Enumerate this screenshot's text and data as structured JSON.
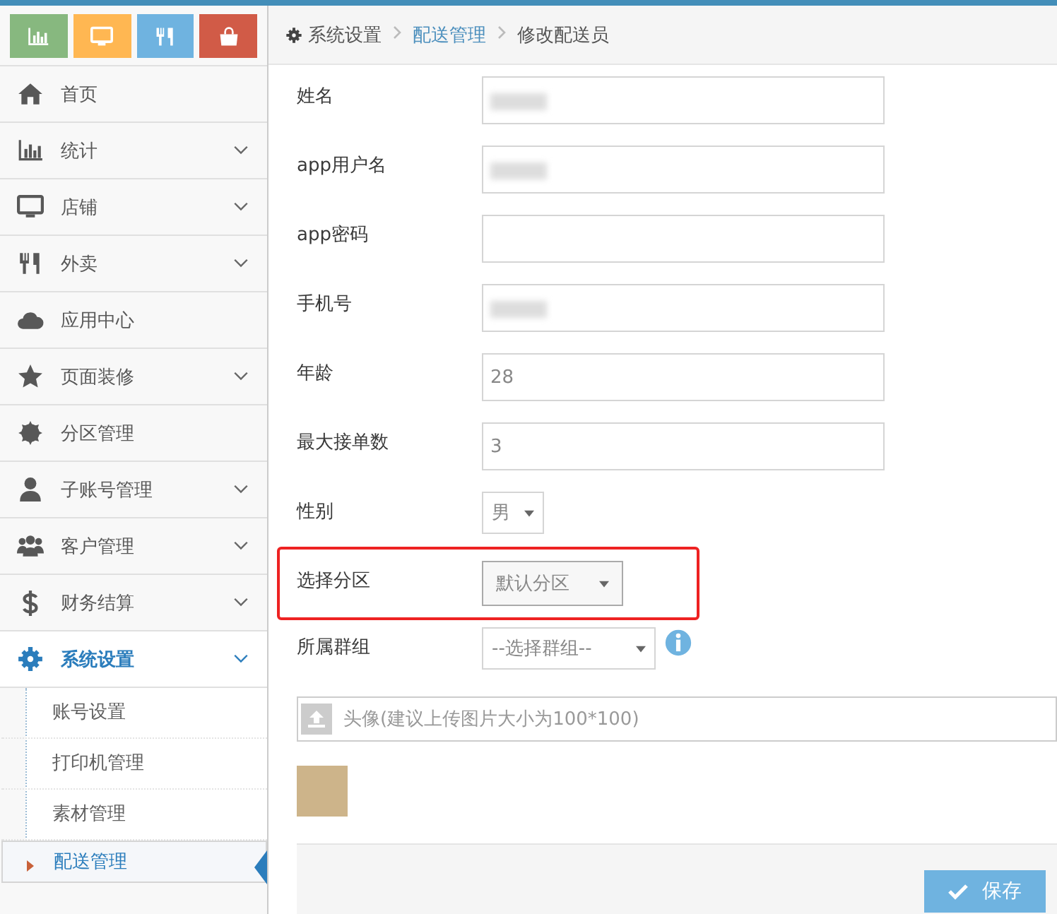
{
  "shortcuts": [
    {
      "kind": "chart",
      "color": "#87b87f"
    },
    {
      "kind": "monitor",
      "color": "#ffb752"
    },
    {
      "kind": "fork",
      "color": "#6fb3e0"
    },
    {
      "kind": "bag",
      "color": "#d15b47"
    }
  ],
  "sidebar": {
    "items": [
      {
        "label": "首页",
        "kind": "home",
        "expandable": false,
        "expanded": false
      },
      {
        "label": "统计",
        "kind": "chart",
        "expandable": true,
        "expanded": false
      },
      {
        "label": "店铺",
        "kind": "monitor",
        "expandable": true,
        "expanded": false
      },
      {
        "label": "外卖",
        "kind": "fork",
        "expandable": true,
        "expanded": false
      },
      {
        "label": "应用中心",
        "kind": "cloud",
        "expandable": false,
        "expanded": false
      },
      {
        "label": "页面装修",
        "kind": "star",
        "expandable": true,
        "expanded": false
      },
      {
        "label": "分区管理",
        "kind": "cog",
        "expandable": false,
        "expanded": false
      },
      {
        "label": "子账号管理",
        "kind": "user",
        "expandable": true,
        "expanded": false
      },
      {
        "label": "客户管理",
        "kind": "users",
        "expandable": true,
        "expanded": false
      },
      {
        "label": "财务结算",
        "kind": "dollar",
        "expandable": true,
        "expanded": false
      },
      {
        "label": "系统设置",
        "kind": "gear",
        "expandable": true,
        "expanded": true,
        "children": [
          {
            "label": "账号设置",
            "selected": false
          },
          {
            "label": "打印机管理",
            "selected": false
          },
          {
            "label": "素材管理",
            "selected": false
          },
          {
            "label": "配送管理",
            "selected": true
          }
        ]
      }
    ]
  },
  "breadcrumb": [
    {
      "label": "系统设置",
      "link": false
    },
    {
      "label": "配送管理",
      "link": true
    },
    {
      "label": "修改配送员",
      "link": false
    }
  ],
  "form": {
    "fields": [
      {
        "label": "姓名",
        "kind": "text",
        "blurred": true
      },
      {
        "label": "app用户名",
        "kind": "text",
        "blurred": true
      },
      {
        "label": "app密码",
        "kind": "text",
        "blurred": false
      },
      {
        "label": "手机号",
        "kind": "text",
        "blurred": true
      },
      {
        "label": "年龄",
        "kind": "text",
        "value": "28",
        "blurred": false
      },
      {
        "label": "最大接单数",
        "kind": "text",
        "value": "3",
        "blurred": false
      },
      {
        "label": "性别",
        "kind": "select-small",
        "value": "男"
      },
      {
        "label": "选择分区",
        "kind": "select-box",
        "value": "默认分区",
        "highlighted": true
      },
      {
        "label": "所属群组",
        "kind": "select-info",
        "value": "--选择群组--"
      }
    ],
    "upload": {
      "placeholder": "头像(建议上传图片大小为100*100)"
    },
    "save_button": "保存"
  }
}
